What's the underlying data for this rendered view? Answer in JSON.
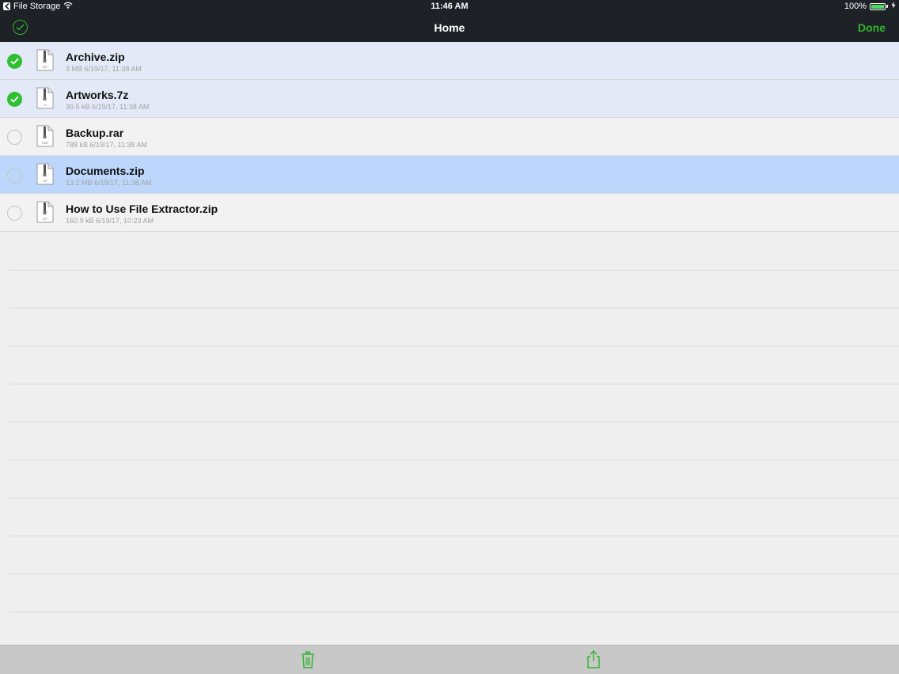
{
  "status_bar": {
    "back_app": "File Storage",
    "time": "11:46 AM",
    "battery": "100%",
    "battery_level": 1.0
  },
  "nav": {
    "title": "Home",
    "done_label": "Done",
    "select_all_icon": "check-circle-icon"
  },
  "files": [
    {
      "name": "Archive.zip",
      "meta": "3 MB 6/19/17, 11:38 AM",
      "selected": true,
      "icon_label": "ZIP"
    },
    {
      "name": "Artworks.7z",
      "meta": "39.5 kB 6/19/17, 11:38 AM",
      "selected": true,
      "icon_label": "7z"
    },
    {
      "name": "Backup.rar",
      "meta": "788 kB 6/19/17, 11:38 AM",
      "selected": false,
      "icon_label": "RAR"
    },
    {
      "name": "Documents.zip",
      "meta": "13.2 MB 6/19/17, 11:38 AM",
      "selected": false,
      "icon_label": "ZIP"
    },
    {
      "name": "How to Use File Extractor.zip",
      "meta": "160.9 kB 6/19/17, 10:23 AM",
      "selected": false,
      "icon_label": "ZIP"
    }
  ],
  "toolbar": {
    "icons": [
      "trash-icon",
      "share-icon"
    ]
  },
  "colors": {
    "accent_green": "#2ec030",
    "bar_dark": "#1e2226",
    "selected_row": "#e3e9f7",
    "highlight_row": "#bcd7fb"
  }
}
